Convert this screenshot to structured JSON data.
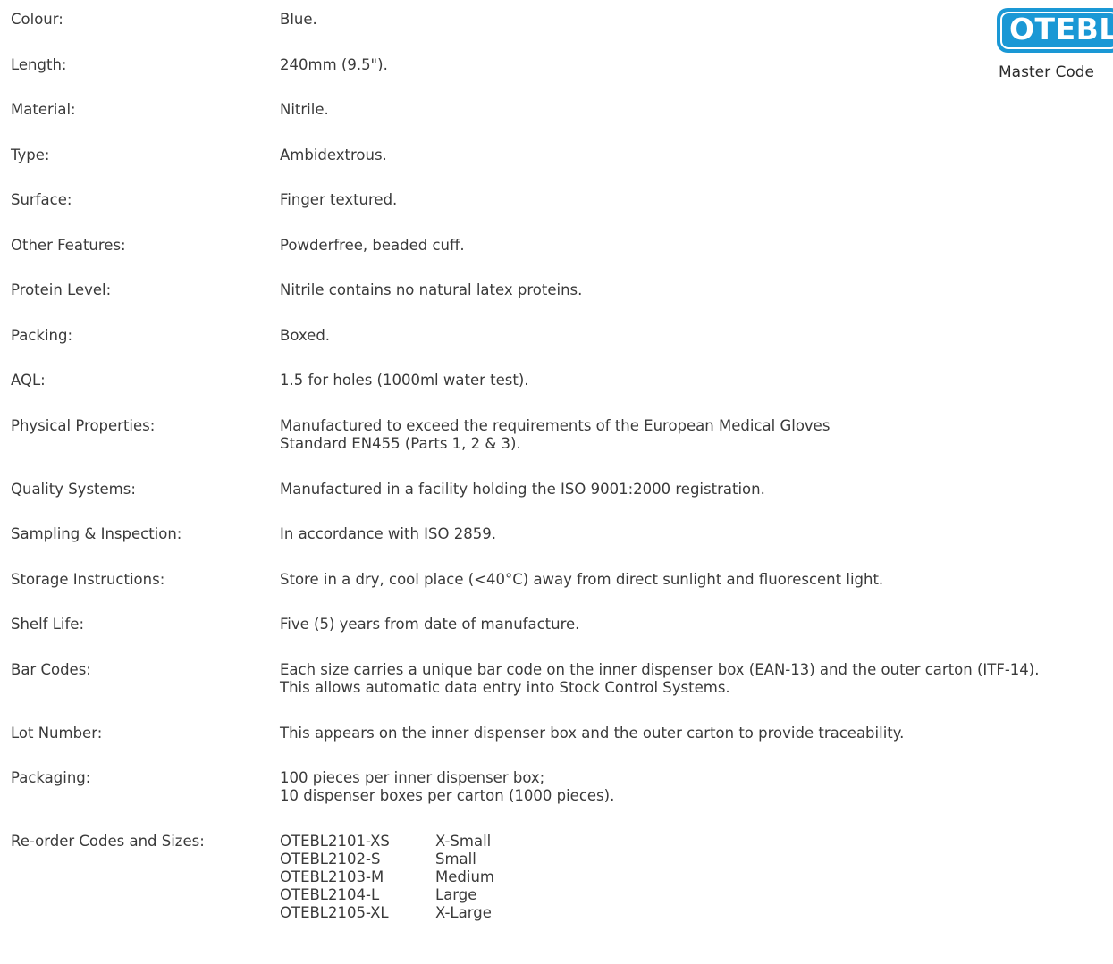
{
  "badge": {
    "code": "OTEBL",
    "subtitle": "Master Code",
    "color": "#1a98d5"
  },
  "specs": [
    {
      "label": "Colour:",
      "value": [
        "Blue."
      ]
    },
    {
      "label": "Length:",
      "value": [
        "240mm (9.5\")."
      ]
    },
    {
      "label": "Material:",
      "value": [
        "Nitrile."
      ]
    },
    {
      "label": "Type:",
      "value": [
        "Ambidextrous."
      ]
    },
    {
      "label": "Surface:",
      "value": [
        "Finger textured."
      ]
    },
    {
      "label": "Other Features:",
      "value": [
        "Powderfree, beaded cuff."
      ]
    },
    {
      "label": "Protein Level:",
      "value": [
        "Nitrile contains no natural latex proteins."
      ]
    },
    {
      "label": "Packing:",
      "value": [
        "Boxed."
      ]
    },
    {
      "label": "AQL:",
      "value": [
        "1.5 for holes (1000ml water test)."
      ]
    },
    {
      "label": "Physical Properties:",
      "value": [
        "Manufactured to exceed the requirements of the European Medical Gloves",
        "Standard EN455 (Parts 1, 2 & 3)."
      ]
    },
    {
      "label": "Quality Systems:",
      "value": [
        "Manufactured in a facility holding the ISO 9001:2000 registration."
      ]
    },
    {
      "label": "Sampling & Inspection:",
      "value": [
        "In accordance with ISO 2859."
      ]
    },
    {
      "label": "Storage Instructions:",
      "value": [
        "Store in a dry, cool place (<40°C) away from direct sunlight and fluorescent light."
      ]
    },
    {
      "label": "Shelf Life:",
      "value": [
        "Five (5) years from date of manufacture."
      ]
    },
    {
      "label": "Bar Codes:",
      "value": [
        "Each size carries a unique bar code on the inner dispenser box (EAN-13) and the outer carton (ITF-14).",
        "This allows automatic data entry into Stock Control Systems."
      ]
    },
    {
      "label": "Lot Number:",
      "value": [
        "This appears on the inner dispenser box and the outer carton to provide traceability."
      ]
    },
    {
      "label": "Packaging:",
      "value": [
        "100 pieces per inner dispenser box;",
        "10 dispenser boxes per carton (1000 pieces)."
      ]
    }
  ],
  "reorder": {
    "label": "Re-order Codes and Sizes:",
    "items": [
      {
        "code": "OTEBL2101-XS",
        "size": "X-Small"
      },
      {
        "code": "OTEBL2102-S",
        "size": "Small"
      },
      {
        "code": "OTEBL2103-M",
        "size": "Medium"
      },
      {
        "code": "OTEBL2104-L",
        "size": "Large"
      },
      {
        "code": "OTEBL2105-XL",
        "size": "X-Large"
      }
    ]
  }
}
